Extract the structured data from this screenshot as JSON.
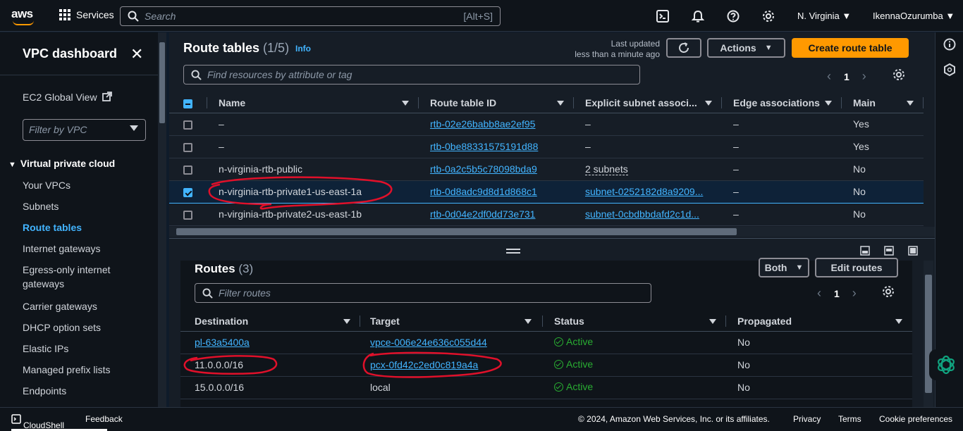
{
  "topbar": {
    "logo": "aws",
    "services": "Services",
    "search_placeholder": "Search",
    "search_hint": "[Alt+S]",
    "region": "N. Virginia",
    "user": "IkennaOzurumba"
  },
  "sidebar": {
    "title": "VPC dashboard",
    "global_view": "EC2 Global View",
    "filter_placeholder": "Filter by VPC",
    "section": "Virtual private cloud",
    "items": [
      "Your VPCs",
      "Subnets",
      "Route tables",
      "Internet gateways",
      "Egress-only internet",
      "gateways",
      "Carrier gateways",
      "DHCP option sets",
      "Elastic IPs",
      "Managed prefix lists",
      "Endpoints"
    ]
  },
  "route_tables": {
    "title": "Route tables",
    "count": "(1/5)",
    "info": "Info",
    "last_updated": "Last updated",
    "updated_ago": "less than a minute ago",
    "actions": "Actions",
    "create": "Create route table",
    "filter_placeholder": "Find resources by attribute or tag",
    "page": "1",
    "columns": [
      "Name",
      "Route table ID",
      "Explicit subnet associ...",
      "Edge associations",
      "Main"
    ],
    "rows": [
      {
        "name": "–",
        "id": "rtb-02e26babb8ae2ef95",
        "subnet": "–",
        "edge": "–",
        "main": "Yes",
        "selected": false
      },
      {
        "name": "–",
        "id": "rtb-0be88331575191d88",
        "subnet": "–",
        "edge": "–",
        "main": "Yes",
        "selected": false
      },
      {
        "name": "n-virginia-rtb-public",
        "id": "rtb-0a2c5b5c78098bda9",
        "subnet": "2 subnets",
        "edge": "–",
        "main": "No",
        "selected": false
      },
      {
        "name": "n-virginia-rtb-private1-us-east-1a",
        "id": "rtb-0d8adc9d8d1d868c1",
        "subnet": "subnet-0252182d8a9209...",
        "edge": "–",
        "main": "No",
        "selected": true
      },
      {
        "name": "n-virginia-rtb-private2-us-east-1b",
        "id": "rtb-0d04e2df0dd73e731",
        "subnet": "subnet-0cbdbbdafd2c1d...",
        "edge": "–",
        "main": "No",
        "selected": false
      }
    ]
  },
  "routes": {
    "title": "Routes",
    "count": "(3)",
    "both": "Both",
    "edit": "Edit routes",
    "filter_placeholder": "Filter routes",
    "page": "1",
    "columns": [
      "Destination",
      "Target",
      "Status",
      "Propagated"
    ],
    "rows": [
      {
        "destination": "pl-63a5400a",
        "target": "vpce-006e24e636c055d44",
        "status": "Active",
        "propagated": "No"
      },
      {
        "destination": "11.0.0.0/16",
        "target": "pcx-0fd42c2ed0c819a4a",
        "status": "Active",
        "propagated": "No"
      },
      {
        "destination": "15.0.0.0/16",
        "target": "local",
        "status": "Active",
        "propagated": "No"
      }
    ]
  },
  "footer": {
    "cloudshell": "CloudShell",
    "feedback": "Feedback",
    "copyright": "© 2024, Amazon Web Services, Inc. or its affiliates.",
    "privacy": "Privacy",
    "terms": "Terms",
    "cookies": "Cookie preferences"
  },
  "colors": {
    "accent": "#42b4ff",
    "primary": "#ff9900",
    "success": "#29ad32",
    "annotation": "#e0102a"
  }
}
